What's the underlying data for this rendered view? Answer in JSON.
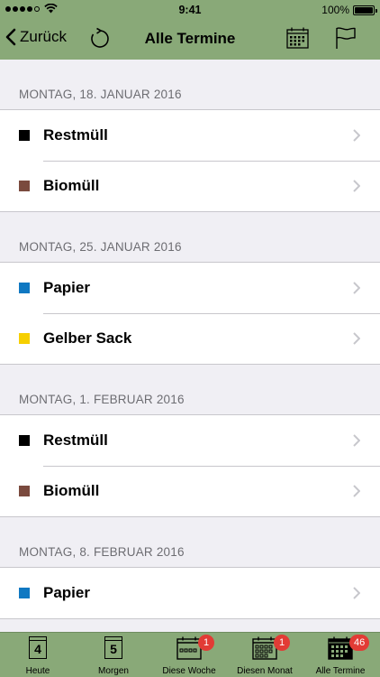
{
  "status_bar": {
    "time": "9:41",
    "battery": "100%"
  },
  "nav": {
    "back_label": "Zurück",
    "title": "Alle Termine"
  },
  "colors": {
    "bar": "#89a978",
    "restmuell": "#000000",
    "biomuell": "#7a4a3e",
    "papier": "#0f78c2",
    "gelber_sack": "#f6cf00"
  },
  "sections": [
    {
      "date": "MONTAG, 18. JANUAR 2016",
      "items": [
        {
          "label": "Restmüll"
        },
        {
          "label": "Biomüll"
        }
      ]
    },
    {
      "date": "MONTAG, 25. JANUAR 2016",
      "items": [
        {
          "label": "Papier"
        },
        {
          "label": "Gelber Sack"
        }
      ]
    },
    {
      "date": "MONTAG, 1. FEBRUAR 2016",
      "items": [
        {
          "label": "Restmüll"
        },
        {
          "label": "Biomüll"
        }
      ]
    },
    {
      "date": "MONTAG, 8. FEBRUAR 2016",
      "items": [
        {
          "label": "Papier"
        }
      ]
    }
  ],
  "tabs": [
    {
      "label": "Heute",
      "icon": "calendar-day-icon",
      "icon_text": "4"
    },
    {
      "label": "Morgen",
      "icon": "calendar-day-icon",
      "icon_text": "5"
    },
    {
      "label": "Diese Woche",
      "icon": "calendar-week-icon",
      "badge": "1"
    },
    {
      "label": "Diesen Monat",
      "icon": "calendar-month-icon",
      "badge": "1"
    },
    {
      "label": "Alle Termine",
      "icon": "calendar-all-icon",
      "badge": "46"
    }
  ]
}
